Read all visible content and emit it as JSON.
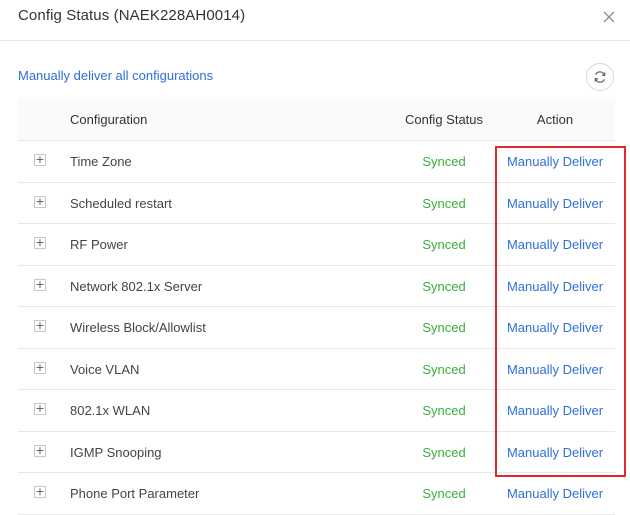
{
  "dialog": {
    "title": "Config Status (NAEK228AH0014)",
    "close_icon": "close-icon"
  },
  "toolbar": {
    "deliver_all_label": "Manually deliver all configurations",
    "refresh_icon": "refresh-icon"
  },
  "table": {
    "headers": {
      "configuration": "Configuration",
      "status": "Config Status",
      "action": "Action"
    },
    "rows": [
      {
        "expand": "+",
        "name": "Time Zone",
        "status": "Synced",
        "action": "Manually Deliver"
      },
      {
        "expand": "+",
        "name": "Scheduled restart",
        "status": "Synced",
        "action": "Manually Deliver"
      },
      {
        "expand": "+",
        "name": "RF Power",
        "status": "Synced",
        "action": "Manually Deliver"
      },
      {
        "expand": "+",
        "name": "Network 802.1x Server",
        "status": "Synced",
        "action": "Manually Deliver"
      },
      {
        "expand": "+",
        "name": "Wireless Block/Allowlist",
        "status": "Synced",
        "action": "Manually Deliver"
      },
      {
        "expand": "+",
        "name": "Voice VLAN",
        "status": "Synced",
        "action": "Manually Deliver"
      },
      {
        "expand": "+",
        "name": "802.1x WLAN",
        "status": "Synced",
        "action": "Manually Deliver"
      },
      {
        "expand": "+",
        "name": "IGMP Snooping",
        "status": "Synced",
        "action": "Manually Deliver"
      },
      {
        "expand": "+",
        "name": "Phone Port Parameter",
        "status": "Synced",
        "action": "Manually Deliver"
      }
    ]
  },
  "colors": {
    "link": "#2f6fdb",
    "synced": "#3bae3b",
    "highlight_border": "#e0292f"
  }
}
